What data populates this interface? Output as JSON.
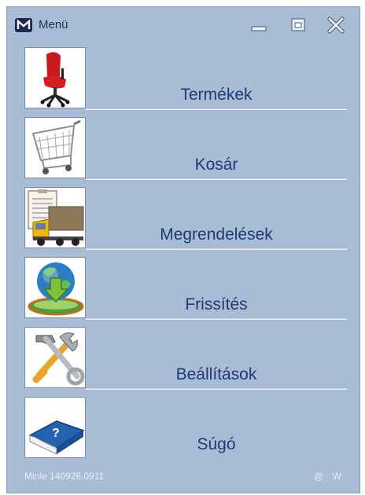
{
  "window": {
    "title": "Menü",
    "version": "Minie 140926.0911",
    "status_flags": "@ W"
  },
  "menu": {
    "items": [
      {
        "label": "Termékek",
        "icon": "office-chair-icon"
      },
      {
        "label": "Kosár",
        "icon": "shopping-cart-icon"
      },
      {
        "label": "Megrendelések",
        "icon": "delivery-truck-icon"
      },
      {
        "label": "Frissítés",
        "icon": "globe-download-icon"
      },
      {
        "label": "Beállítások",
        "icon": "hammer-wrench-icon"
      },
      {
        "label": "Súgó",
        "icon": "help-book-icon"
      }
    ]
  },
  "colors": {
    "window_bg": "#a9bcd6",
    "label_text": "#1f3b73"
  }
}
